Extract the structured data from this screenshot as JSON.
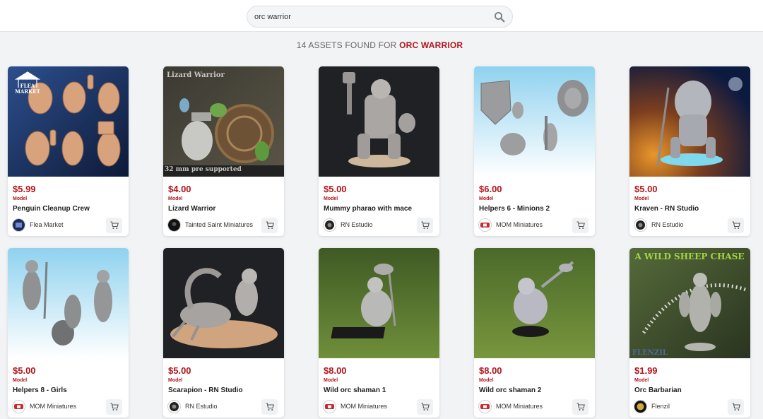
{
  "search": {
    "value": "orc warrior",
    "placeholder": ""
  },
  "results": {
    "prefix": "14 ASSETS FOUND FOR",
    "query": "ORC WARRIOR"
  },
  "colors": {
    "accent": "#b3151b",
    "background": "#f2f3f5"
  },
  "cards": [
    {
      "price": "$5.99",
      "type": "Model",
      "title": "Penguin Cleanup Crew",
      "seller": "Flea Market",
      "overlay": [
        "FLEA",
        "MARKET"
      ]
    },
    {
      "price": "$4.00",
      "type": "Model",
      "title": "Lizard Warrior",
      "seller": "Tainted Saint Miniatures",
      "overlay": [
        "Lizard Warrior",
        "32 mm pre supported"
      ]
    },
    {
      "price": "$5.00",
      "type": "Model",
      "title": "Mummy pharao with mace",
      "seller": "RN Estudio"
    },
    {
      "price": "$6.00",
      "type": "Model",
      "title": "Helpers 6 - Minions 2",
      "seller": "MOM Miniatures"
    },
    {
      "price": "$5.00",
      "type": "Model",
      "title": "Kraven - RN Studio",
      "seller": "RN Estudio"
    },
    {
      "price": "$5.00",
      "type": "Model",
      "title": "Helpers 8 - Girls",
      "seller": "MOM Miniatures"
    },
    {
      "price": "$5.00",
      "type": "Model",
      "title": "Scarapion - RN Studio",
      "seller": "RN Estudio"
    },
    {
      "price": "$8.00",
      "type": "Model",
      "title": "Wild orc shaman 1",
      "seller": "MOM Miniatures"
    },
    {
      "price": "$8.00",
      "type": "Model",
      "title": "Wild orc shaman 2",
      "seller": "MOM Miniatures"
    },
    {
      "price": "$1.99",
      "type": "Model",
      "title": "Orc Barbarian",
      "seller": "Flenzil",
      "overlay": [
        "A WILD SHEEP CHASE",
        "FLENZIL"
      ]
    }
  ],
  "icons": {
    "search": "search-icon",
    "cart": "cart-icon"
  }
}
